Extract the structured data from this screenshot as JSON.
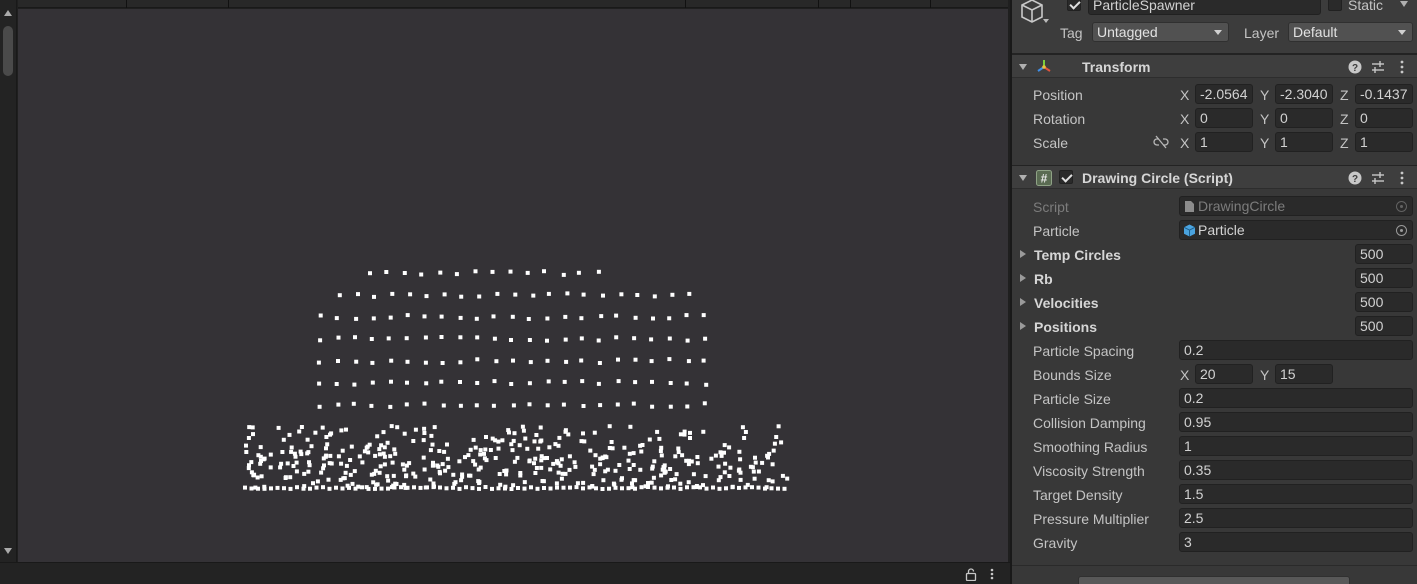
{
  "object": {
    "name": "ParticleSpawner",
    "active": true,
    "static_label": "Static",
    "tag_label": "Tag",
    "tag_value": "Untagged",
    "layer_label": "Layer",
    "layer_value": "Default"
  },
  "transform": {
    "title": "Transform",
    "position": {
      "label": "Position",
      "x": "-2.0564",
      "y": "-2.3040",
      "z": "-0.1437"
    },
    "rotation": {
      "label": "Rotation",
      "x": "0",
      "y": "0",
      "z": "0"
    },
    "scale": {
      "label": "Scale",
      "x": "1",
      "y": "1",
      "z": "1"
    }
  },
  "axes": {
    "x": "X",
    "y": "Y",
    "z": "Z"
  },
  "script_component": {
    "title": "Drawing Circle (Script)",
    "enabled": true,
    "script": {
      "label": "Script",
      "value": "DrawingCircle"
    },
    "particle": {
      "label": "Particle",
      "value": "Particle"
    },
    "arrays": [
      {
        "label": "Temp Circles",
        "size": "500"
      },
      {
        "label": "Rb",
        "size": "500"
      },
      {
        "label": "Velocities",
        "size": "500"
      },
      {
        "label": "Positions",
        "size": "500"
      }
    ],
    "particle_spacing": {
      "label": "Particle Spacing",
      "value": "0.2"
    },
    "bounds_size": {
      "label": "Bounds Size",
      "x": "20",
      "y": "15"
    },
    "fields": [
      {
        "label": "Particle Size",
        "value": "0.2"
      },
      {
        "label": "Collision Damping",
        "value": "0.95"
      },
      {
        "label": "Smoothing Radius",
        "value": "1"
      },
      {
        "label": "Viscosity Strength",
        "value": "0.35"
      },
      {
        "label": "Target Density",
        "value": "1.5"
      },
      {
        "label": "Pressure Multiplier",
        "value": "2.5"
      },
      {
        "label": "Gravity",
        "value": "3"
      }
    ]
  },
  "colors": {
    "scene_background": "#343236",
    "particle": "#ffffff",
    "inspector_background": "#383838"
  },
  "icons": [
    "cube-icon",
    "transform-gizmo-icon",
    "script-hash-icon",
    "help-icon",
    "presets-icon",
    "kebab-menu-icon",
    "unlink-icon",
    "object-picker-icon",
    "lock-icon"
  ]
}
